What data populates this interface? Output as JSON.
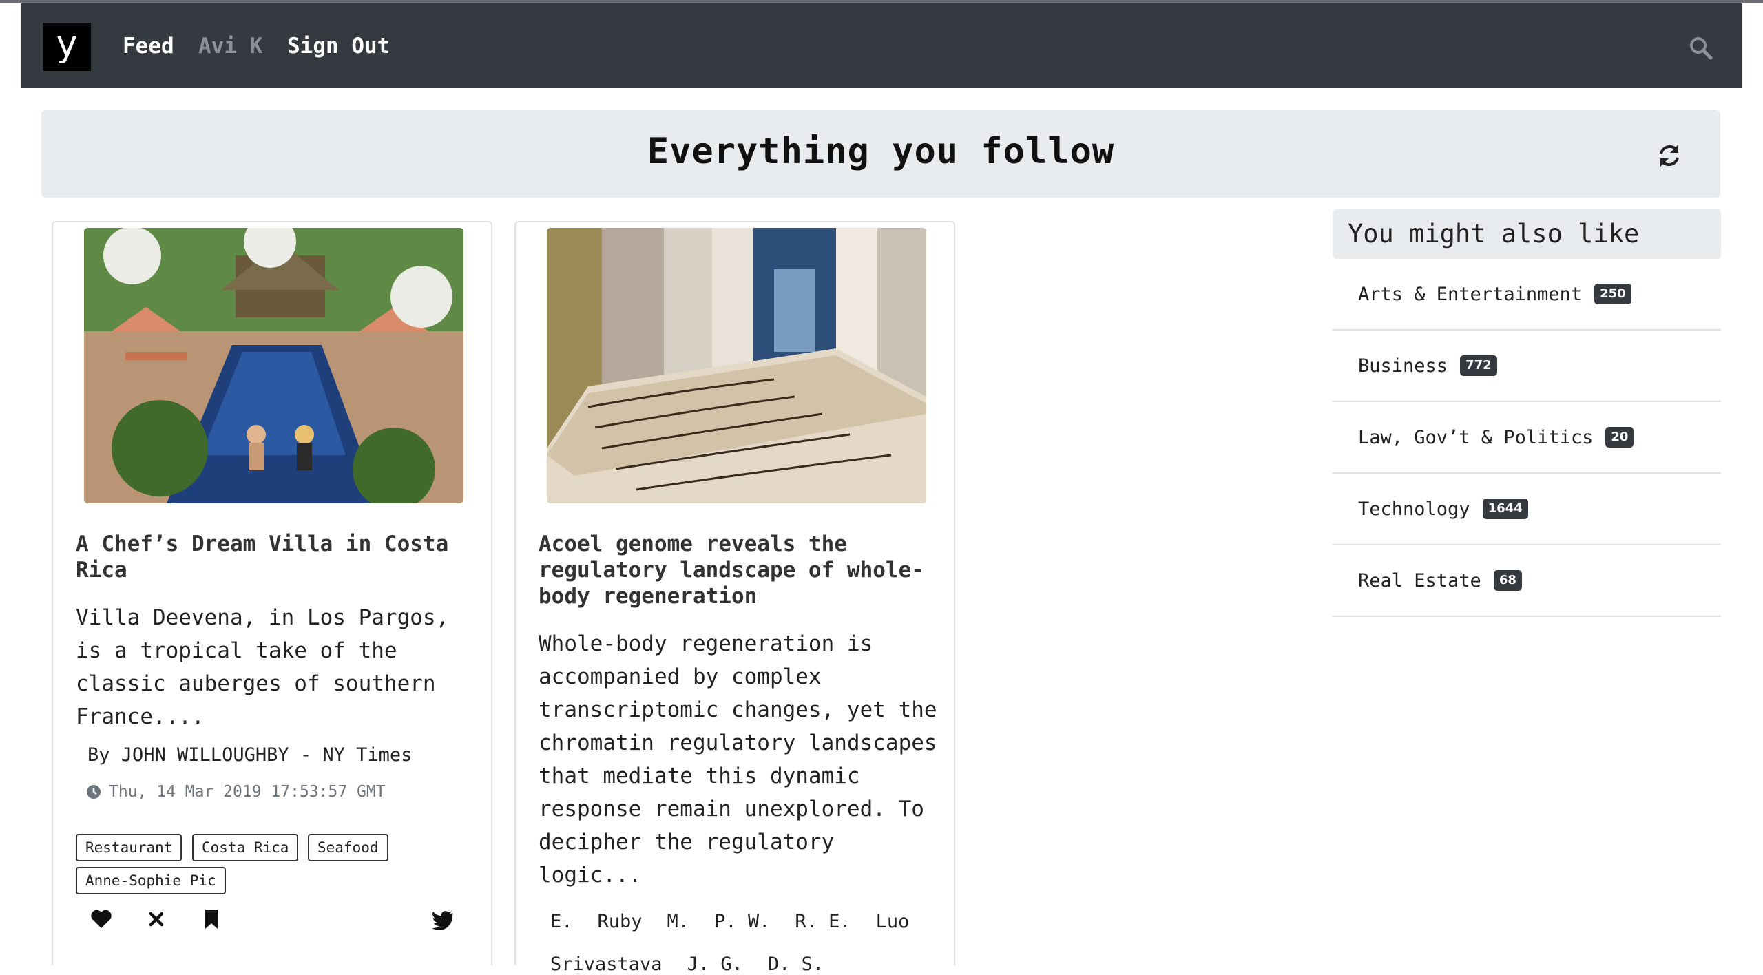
{
  "nav": {
    "logo": "y",
    "feed": "Feed",
    "user": "Avi K",
    "signout": "Sign Out",
    "search_icon": "search-icon"
  },
  "header": {
    "title": "Everything you follow",
    "refresh_icon": "refresh-icon"
  },
  "cards": [
    {
      "title": "A Chef’s Dream Villa in Costa Rica",
      "excerpt": "Villa Deevena, in Los Pargos, is a tropical take of the classic auberges of southern France....",
      "byline": "By JOHN WILLOUGHBY - NY Times",
      "date": "Thu, 14 Mar 2019 17:53:57 GMT",
      "tags": [
        "Restaurant",
        "Costa Rica",
        "Seafood",
        "Anne-Sophie Pic"
      ]
    },
    {
      "title": "Acoel genome reveals the regulatory landscape of whole-body regeneration",
      "excerpt": "Whole-body regeneration is accompanied by complex transcriptomic changes, yet the chromatin regulatory landscapes that mediate this dynamic response remain unexplored. To decipher the regulatory logic...",
      "authors": [
        "E.",
        "Ruby",
        "M.",
        "P. W.",
        "R. E.",
        "Luo",
        "Srivastava",
        "J. G.",
        "D. S."
      ]
    }
  ],
  "sidebar": {
    "heading": "You might also like",
    "items": [
      {
        "label": "Arts & Entertainment",
        "count": "250"
      },
      {
        "label": "Business",
        "count": "772"
      },
      {
        "label": "Law, Gov’t & Politics",
        "count": "20"
      },
      {
        "label": "Technology",
        "count": "1644"
      },
      {
        "label": "Real Estate",
        "count": "68"
      }
    ]
  }
}
